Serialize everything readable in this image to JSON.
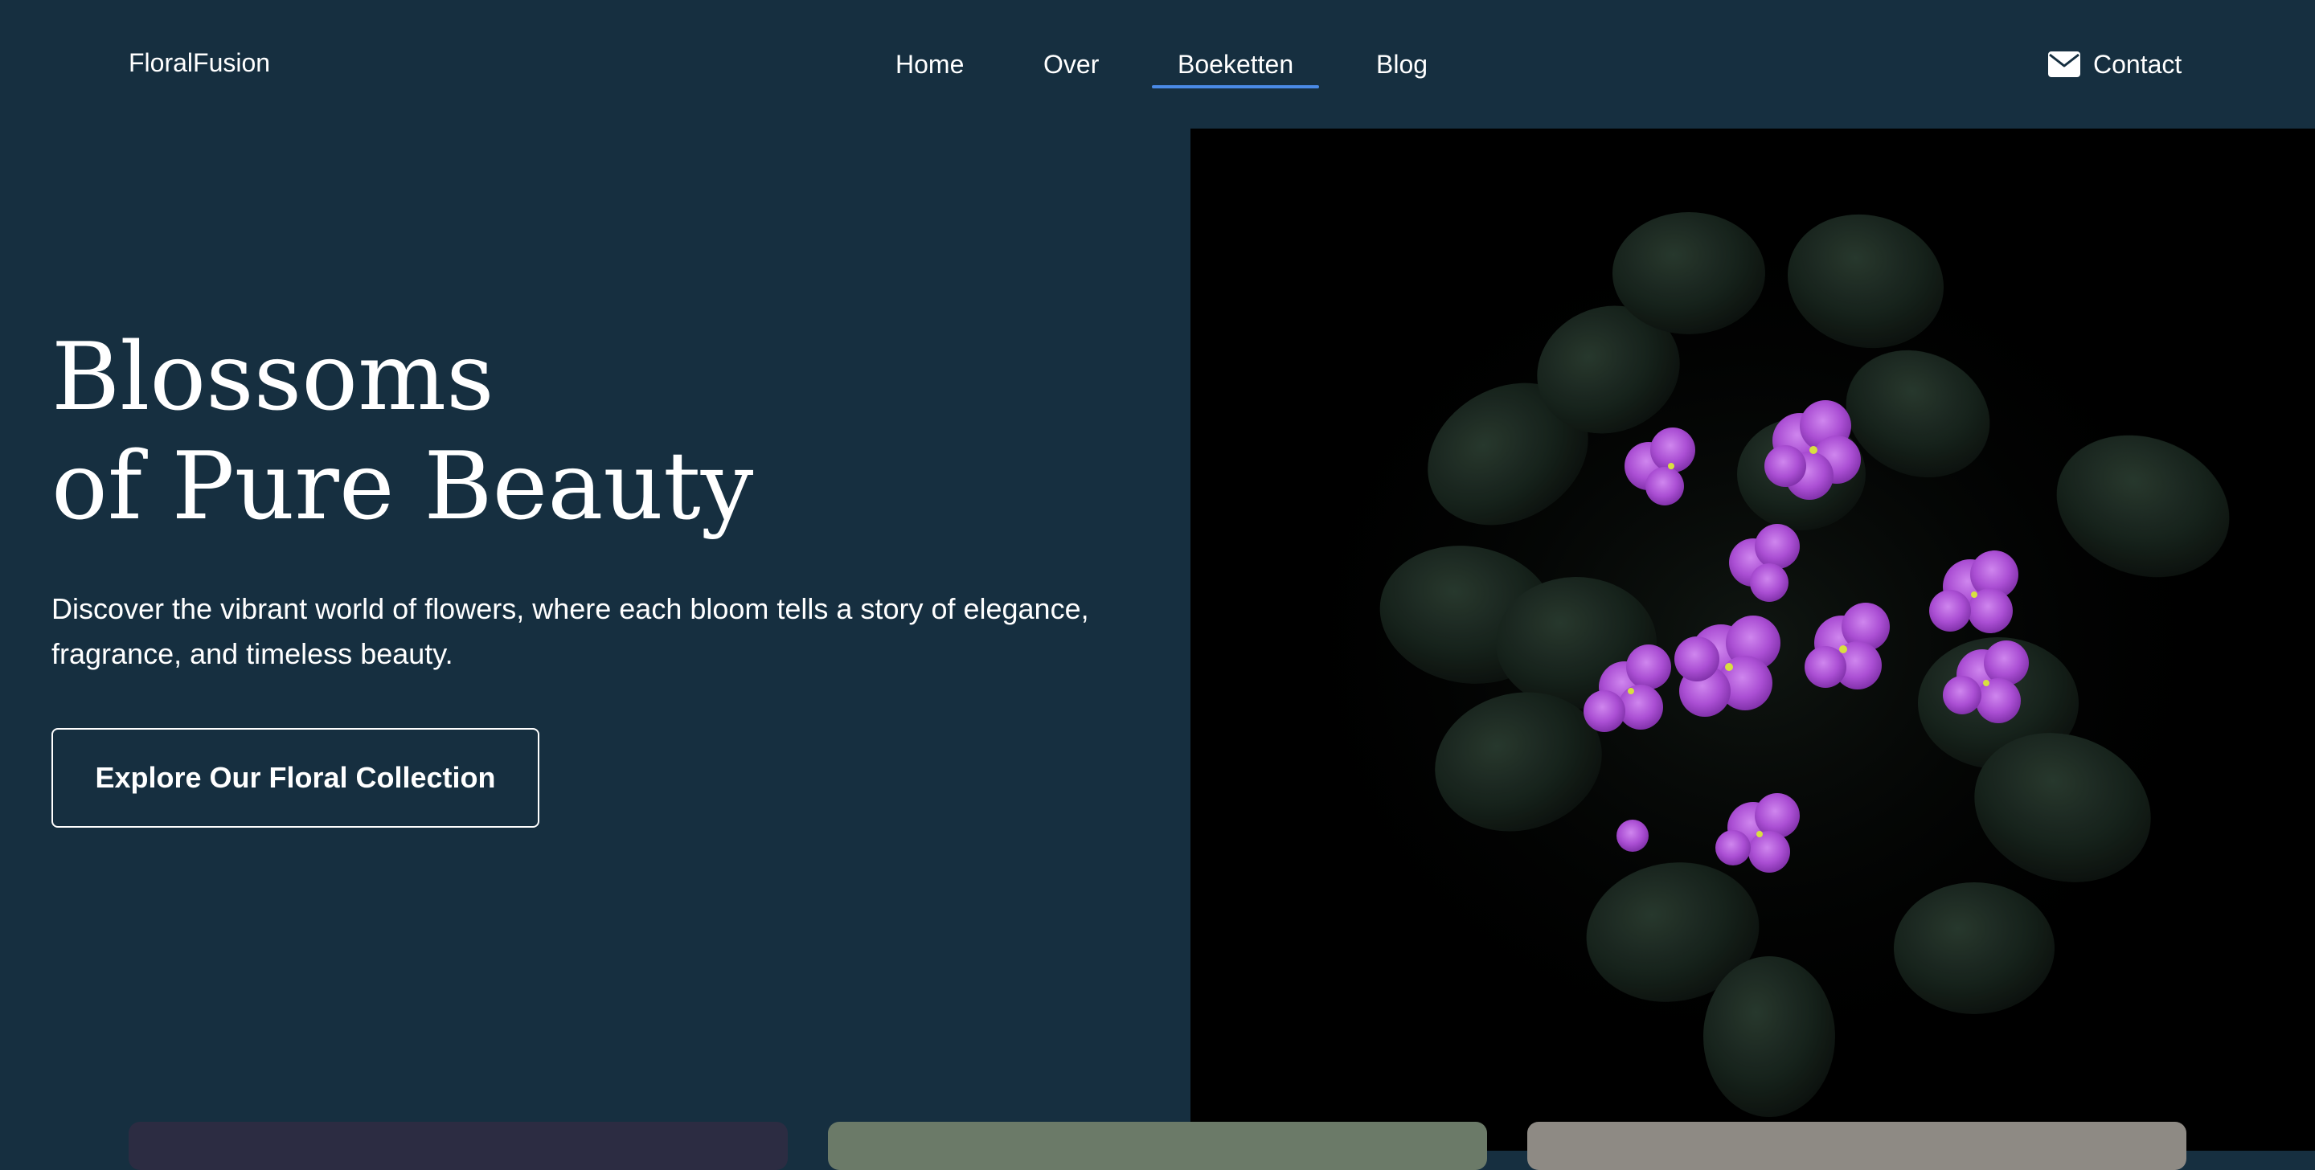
{
  "nav": {
    "brand": "FloralFusion",
    "links": [
      {
        "label": "Home"
      },
      {
        "label": "Over"
      },
      {
        "label": "Boeketten",
        "active": true
      },
      {
        "label": "Blog"
      }
    ],
    "contact": {
      "label": "Contact",
      "icon": "envelope-icon"
    }
  },
  "hero": {
    "title_line1": "Blossoms",
    "title_line2": "of Pure Beauty",
    "subtitle": "Discover the vibrant world of flowers, where each bloom tells a story of elegance, fragrance, and timeless beauty.",
    "cta_label": "Explore Our Floral Collection"
  },
  "colors": {
    "background": "#162f40",
    "accent": "#4a8ae6",
    "image_background": "#000000",
    "card_1": "#2c2c42",
    "card_2": "#6b7a68",
    "card_3": "#8e8a84"
  }
}
